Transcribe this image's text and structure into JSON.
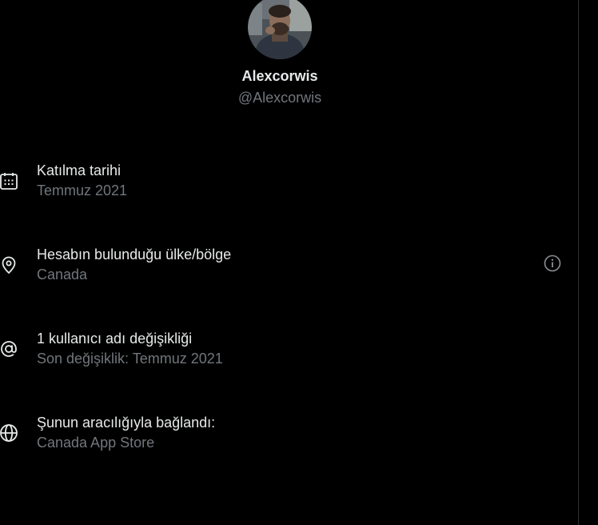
{
  "profile": {
    "display_name": "Alexcorwis",
    "handle": "@Alexcorwis"
  },
  "about": {
    "rows": [
      {
        "icon": "calendar-icon",
        "label": "Katılma tarihi",
        "value": "Temmuz 2021"
      },
      {
        "icon": "location-pin-icon",
        "label": "Hesabın bulunduğu ülke/bölge",
        "value": "Canada",
        "trailing_icon": "info-icon"
      },
      {
        "icon": "at-sign-icon",
        "label": "1 kullanıcı adı değişikliği",
        "value": "Son değişiklik: Temmuz 2021"
      },
      {
        "icon": "globe-icon",
        "label": "Şunun aracılığıyla bağlandı:",
        "value": "Canada App Store"
      }
    ]
  },
  "colors": {
    "background": "#000000",
    "primary_text": "#e7e9ea",
    "secondary_text": "#71767b",
    "divider": "#2f3336"
  }
}
